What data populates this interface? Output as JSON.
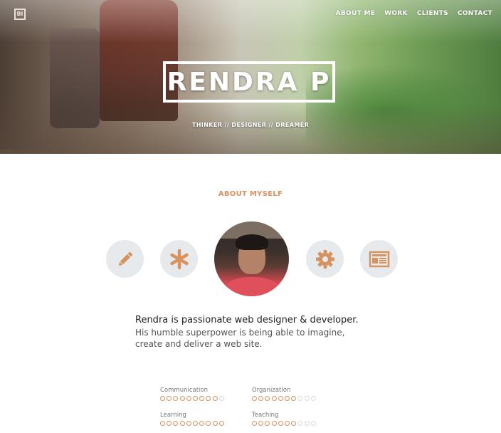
{
  "header": {
    "logo": "BI",
    "nav": [
      "ABOUT ME",
      "WORK",
      "CLIENTS",
      "CONTACT"
    ],
    "title": "RENDRA P",
    "tagline": "THINKER // DESIGNER // DREAMER"
  },
  "about": {
    "title": "ABOUT MYSELF",
    "lead": "Rendra is passionate web designer & developer.",
    "description": "His humble superpower is being able to imagine, create and deliver a web site.",
    "icons": [
      "pencil-icon",
      "asterisk-icon",
      "avatar",
      "gear-icon",
      "newspaper-icon"
    ]
  },
  "skills": [
    {
      "name": "Communication",
      "level": 9,
      "max": 10
    },
    {
      "name": "Organization",
      "level": 7,
      "max": 10
    },
    {
      "name": "Learning",
      "level": 10,
      "max": 10
    },
    {
      "name": "Teaching",
      "level": 7,
      "max": 10
    }
  ],
  "colors": {
    "accent": "#d7935f",
    "icon_bg": "#e7eaec"
  }
}
